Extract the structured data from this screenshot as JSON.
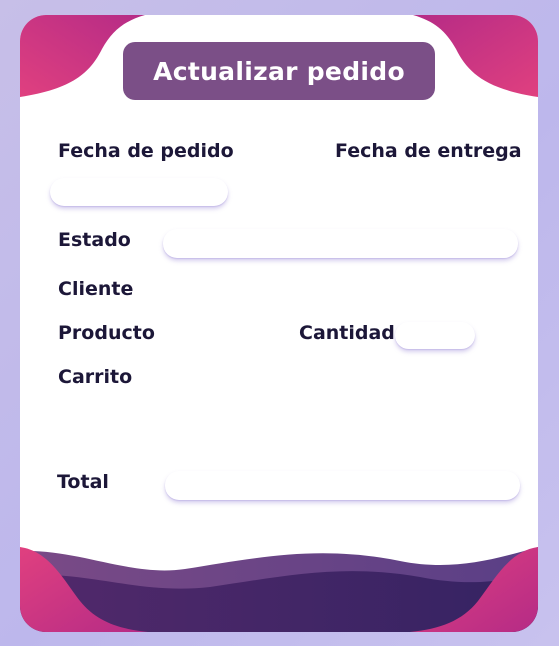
{
  "header": {
    "title": "Actualizar pedido"
  },
  "form": {
    "fecha_pedido": {
      "label": "Fecha de pedido",
      "value": "",
      "placeholder": ""
    },
    "fecha_entrega": {
      "label": "Fecha de entrega"
    },
    "estado": {
      "label": "Estado",
      "value": "",
      "placeholder": ""
    },
    "cliente": {
      "label": "Cliente"
    },
    "producto": {
      "label": "Producto"
    },
    "cantidad": {
      "label": "Cantidad",
      "value": "",
      "placeholder": ""
    },
    "carrito": {
      "label": "Carrito"
    },
    "total": {
      "label": "Total",
      "value": "",
      "placeholder": ""
    }
  },
  "colors": {
    "background": "#c2bbea",
    "title_pill": "#7b4f87",
    "label_text": "#1c1738",
    "corner_accent": "#d93a7e",
    "wave_dark": "#3b1f5e"
  }
}
